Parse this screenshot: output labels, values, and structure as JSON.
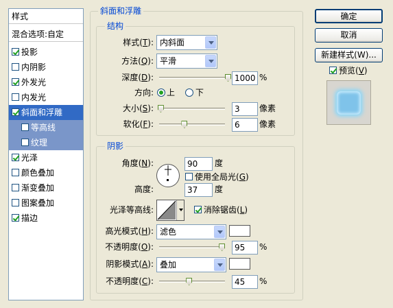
{
  "style_list": {
    "header": "样式",
    "blend_options": "混合选项:自定",
    "items": [
      {
        "label": "投影",
        "checked": true
      },
      {
        "label": "内阴影",
        "checked": false
      },
      {
        "label": "外发光",
        "checked": true
      },
      {
        "label": "内发光",
        "checked": false
      },
      {
        "label": "斜面和浮雕",
        "checked": true,
        "selected": true
      },
      {
        "label": "等高线",
        "checked": false,
        "sub": true
      },
      {
        "label": "纹理",
        "checked": false,
        "sub": true
      },
      {
        "label": "光泽",
        "checked": true
      },
      {
        "label": "颜色叠加",
        "checked": false
      },
      {
        "label": "渐变叠加",
        "checked": false
      },
      {
        "label": "图案叠加",
        "checked": false
      },
      {
        "label": "描边",
        "checked": true
      }
    ]
  },
  "bevel": {
    "title": "斜面和浮雕",
    "structure": {
      "title": "结构",
      "style_label": "样式",
      "style_key": "T",
      "style_value": "内斜面",
      "technique_label": "方法",
      "technique_key": "Q",
      "technique_value": "平滑",
      "depth_label": "深度",
      "depth_key": "D",
      "depth_value": "1000",
      "depth_unit": "%",
      "depth_fraction": 1.0,
      "direction_label": "方向:",
      "direction_up": "上",
      "direction_down": "下",
      "direction_selected": "up",
      "size_label": "大小",
      "size_key": "S",
      "size_value": "3",
      "size_unit": "像素",
      "size_fraction": 0.02,
      "soften_label": "软化",
      "soften_key": "F",
      "soften_value": "6",
      "soften_unit": "像素",
      "soften_fraction": 0.38
    },
    "shading": {
      "title": "阴影",
      "angle_label": "角度",
      "angle_key": "N",
      "angle_value": "90",
      "angle_unit": "度",
      "global_light_label": "使用全局光",
      "global_light_key": "G",
      "global_light_checked": false,
      "altitude_label": "高度:",
      "altitude_value": "37",
      "altitude_unit": "度",
      "gloss_label": "光泽等高线:",
      "antialias_label": "消除锯齿",
      "antialias_key": "L",
      "antialias_checked": true,
      "highlight_mode_label": "高光模式",
      "highlight_mode_key": "H",
      "highlight_mode_value": "滤色",
      "highlight_color": "#ffffff",
      "highlight_opacity_label": "不透明度",
      "highlight_opacity_key": "O",
      "highlight_opacity_value": "95",
      "highlight_opacity_unit": "%",
      "highlight_opacity_fraction": 0.95,
      "shadow_mode_label": "阴影模式",
      "shadow_mode_key": "A",
      "shadow_mode_value": "叠加",
      "shadow_color": "#ffffff",
      "shadow_opacity_label": "不透明度",
      "shadow_opacity_key": "C",
      "shadow_opacity_value": "45",
      "shadow_opacity_unit": "%",
      "shadow_opacity_fraction": 0.45
    }
  },
  "buttons": {
    "ok": "确定",
    "cancel": "取消",
    "new_style": "新建样式(W)...",
    "preview_label": "预览",
    "preview_key": "V",
    "preview_checked": true
  }
}
